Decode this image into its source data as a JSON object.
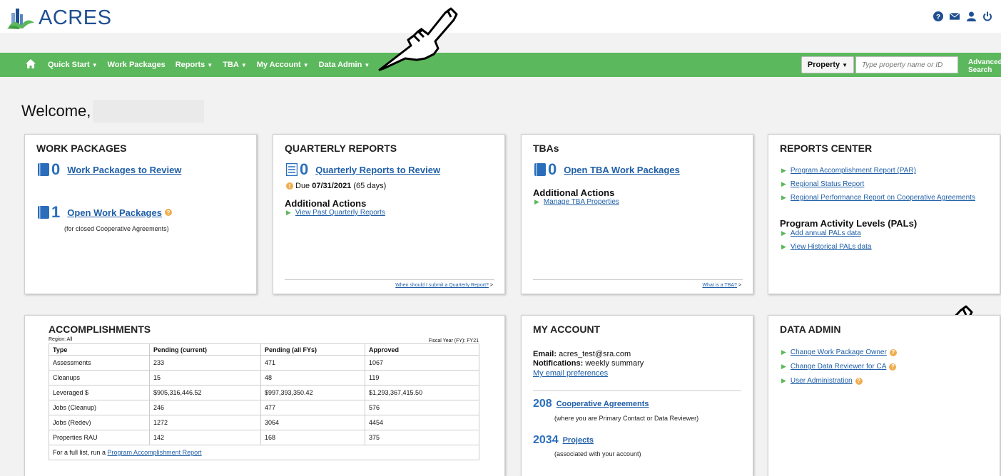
{
  "app": {
    "logo": "ACRES"
  },
  "nav": {
    "items": [
      {
        "label": "Quick Start",
        "caret": true
      },
      {
        "label": "Work Packages",
        "caret": false
      },
      {
        "label": "Reports",
        "caret": true
      },
      {
        "label": "TBA",
        "caret": true
      },
      {
        "label": "My Account",
        "caret": true
      },
      {
        "label": "Data Admin",
        "caret": true
      }
    ],
    "property_button": "Property",
    "search_placeholder": "Type property name or ID",
    "advanced_search": [
      "Advanced",
      "Search"
    ]
  },
  "welcome": "Welcome,",
  "work_packages": {
    "title": "WORK PACKAGES",
    "review_count": "0",
    "review_label": "Work Packages to Review",
    "open_count": "1",
    "open_label": "Open Work Packages",
    "open_note": "(for closed Cooperative Agreements)"
  },
  "quarterly": {
    "title": "QUARTERLY REPORTS",
    "count": "0",
    "label": "Quarterly Reports to Review",
    "due_prefix": "Due",
    "due_date": "07/31/2021",
    "due_days": "(65 days)",
    "additional": "Additional Actions",
    "action": "View Past Quarterly Reports",
    "footer_link": "When should I submit a Quarterly Report?"
  },
  "tbas": {
    "title": "TBAs",
    "count": "0",
    "label": "Open TBA Work Packages",
    "additional": "Additional Actions",
    "action": "Manage TBA Properties",
    "footer_link": "What is a TBA?"
  },
  "reports_center": {
    "title": "REPORTS CENTER",
    "links": [
      "Program Accomplishment Report (PAR)",
      "Regional Status Report",
      "Regional Performance Report on Cooperative Agreements"
    ],
    "pals_title": "Program Activity Levels (PALs)",
    "pals_links": [
      "Add annual PALs data",
      "View Historical PALs data"
    ]
  },
  "accomplishments": {
    "title": "ACCOMPLISHMENTS",
    "region": "Region: All",
    "fiscal_year": "Fiscal Year (FY): FY21",
    "columns": [
      "Type",
      "Pending (current)",
      "Pending (all FYs)",
      "Approved"
    ],
    "rows": [
      [
        "Assessments",
        "233",
        "471",
        "1067"
      ],
      [
        "Cleanups",
        "15",
        "48",
        "119"
      ],
      [
        "Leveraged $",
        "$905,316,446.52",
        "$997,393,350.42",
        "$1,293,367,415.50"
      ],
      [
        "Jobs (Cleanup)",
        "246",
        "477",
        "576"
      ],
      [
        "Jobs (Redev)",
        "1272",
        "3064",
        "4454"
      ],
      [
        "Properties RAU",
        "142",
        "168",
        "375"
      ]
    ],
    "footer_prefix": "For a full list, run a",
    "footer_link": "Program Accomplishment Report"
  },
  "my_account": {
    "title": "MY ACCOUNT",
    "email_label": "Email:",
    "email": "acres_test@sra.com",
    "notif_label": "Notifications:",
    "notif": "weekly summary",
    "prefs_link": "My email preferences",
    "ca_count": "208",
    "ca_label": "Cooperative Agreements",
    "ca_note": "(where you are Primary Contact or Data Reviewer)",
    "proj_count": "2034",
    "proj_label": "Projects",
    "proj_note": "(associated with your account)"
  },
  "data_admin": {
    "title": "DATA ADMIN",
    "links": [
      "Change Work Package Owner",
      "Change Data Reviewer for CA",
      "User Administration"
    ]
  },
  "colors": {
    "nav_green": "#5cb85c",
    "link_blue": "#1f5fa8",
    "number_blue": "#2a6ebb",
    "help_orange": "#f0ad4e",
    "logo_blue": "#1f4e91"
  }
}
